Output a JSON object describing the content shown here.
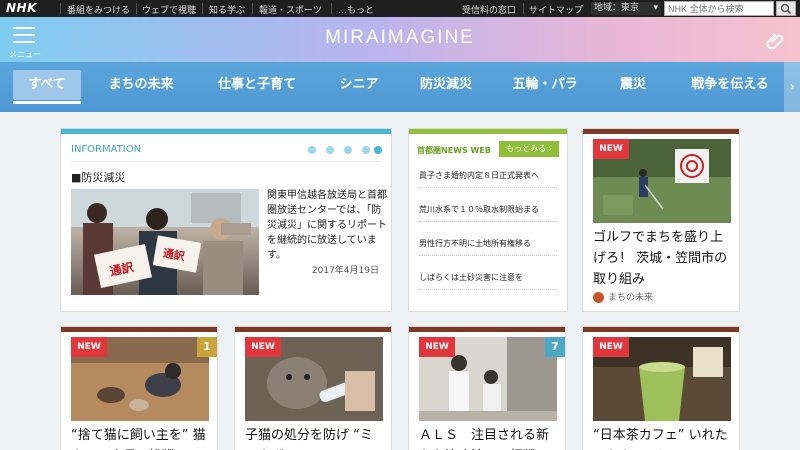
{
  "topbar": {
    "logo": "NHK",
    "nav": [
      "番組をみつける",
      "ウェブで視聴",
      "知る学ぶ",
      "報道・スポーツ",
      "…もっと"
    ],
    "links": [
      "受信料の窓口",
      "サイトマップ"
    ],
    "region_label": "地域：東京",
    "search_placeholder": "NHK 全体から検索"
  },
  "brand": {
    "menu_label": "メニュー",
    "title": "MIRAIMAGINE"
  },
  "tabs": [
    {
      "label": "すべて",
      "active": true
    },
    {
      "label": "まちの未来",
      "active": false
    },
    {
      "label": "仕事と子育て",
      "active": false
    },
    {
      "label": "シニア",
      "active": false
    },
    {
      "label": "防災減災",
      "active": false
    },
    {
      "label": "五輪・パラ",
      "active": false
    },
    {
      "label": "震災",
      "active": false
    },
    {
      "label": "戦争を伝える",
      "active": false
    }
  ],
  "info": {
    "heading": "INFORMATION",
    "category": "■防災減災",
    "body": "関東甲信越各放送局と首都圏放送センターでは、「防災減災」に関するリポートを継続的に放送しています。",
    "date": "2017年4月19日",
    "photo_signs": [
      "通訳",
      "通訳"
    ]
  },
  "newsweb": {
    "label": "首都圏NEWS WEB",
    "more": "もっとみる ›",
    "items": [
      "眞子さま婚約内定８日正式発表へ",
      "荒川水系で１０％取水制限始まる",
      "男性行方不明に土地所有権移る",
      "しばらくは土砂災害に注意を"
    ]
  },
  "stories": [
    {
      "badge": "NEW",
      "headline": "ゴルフでまちを盛り上げろ！ 茨城・笠間市の取り組み",
      "tag": "まちの未来",
      "count": ""
    },
    {
      "badge": "NEW",
      "headline": "“捨て猫に飼い主を” 猫カフェ店長の挑戦",
      "tag": "",
      "count": "1"
    },
    {
      "badge": "NEW",
      "headline": "子猫の処分を防げ “ミルクボランティア”",
      "tag": "",
      "count": ""
    },
    {
      "badge": "NEW",
      "headline": "ＡＬＳ　注目される新たな治療法への拒戦",
      "tag": "",
      "count": "7"
    },
    {
      "badge": "NEW",
      "headline": "“日本茶カフェ” いれたてをクールに",
      "tag": "",
      "count": ""
    }
  ],
  "colors": {
    "tab_bar": "#5aa6dc",
    "new_badge": "#e2363d",
    "info_accent": "#45b6cf",
    "news_accent": "#8fbf39",
    "card_cap": "#7b3a26"
  }
}
